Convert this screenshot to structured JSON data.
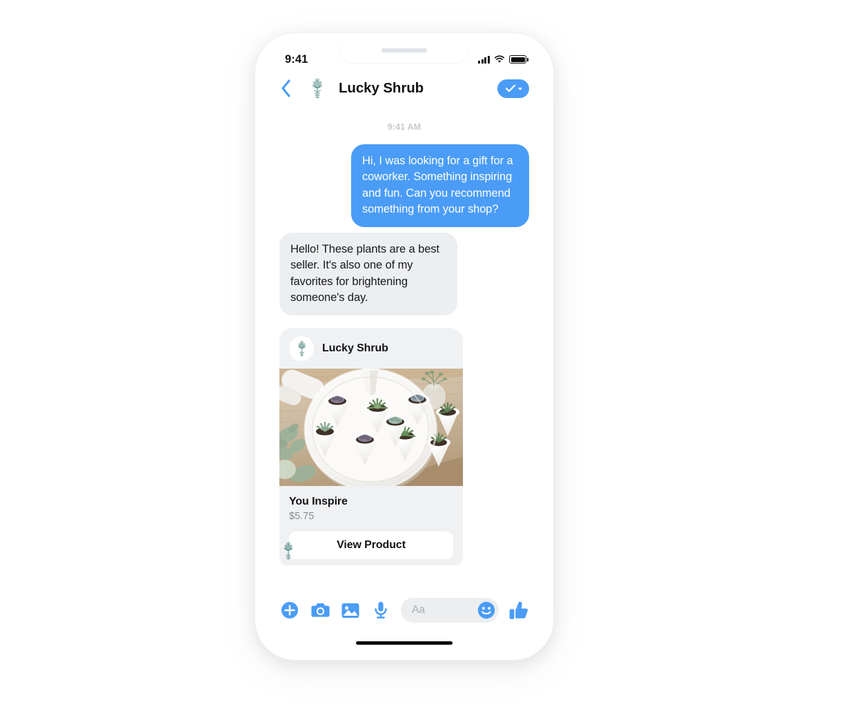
{
  "status_bar": {
    "time": "9:41",
    "signal_icon": "signal-bars-icon",
    "wifi_icon": "wifi-icon",
    "battery_icon": "battery-icon"
  },
  "header": {
    "back_icon": "chevron-left-icon",
    "logo_icon": "lucky-shrub-logo-icon",
    "title": "Lucky Shrub",
    "verified_icon": "check-icon",
    "verified_caret_icon": "caret-down-icon"
  },
  "conversation": {
    "timestamp": "9:41 AM",
    "messages": [
      {
        "direction": "out",
        "text": "Hi, I was looking for a gift for a coworker. Something inspiring and fun. Can you recommend something from your shop?"
      },
      {
        "direction": "in",
        "text": "Hello! These plants are a best seller. It's also one of my favorites for brightening someone's day."
      }
    ],
    "thread_avatar_icon": "lucky-shrub-avatar-icon"
  },
  "product_card": {
    "brand": "Lucky Shrub",
    "brand_avatar_icon": "lucky-shrub-avatar-icon",
    "photo_alt": "White round tray with succulent plants in cone holders on a wooden table",
    "name": "You Inspire",
    "price": "$5.75",
    "cta_label": "View Product"
  },
  "composer": {
    "add_icon": "plus-circle-icon",
    "camera_icon": "camera-icon",
    "gallery_icon": "image-icon",
    "mic_icon": "microphone-icon",
    "input_value": "",
    "input_placeholder": "Aa",
    "emoji_icon": "smiley-icon",
    "like_icon": "thumbs-up-icon"
  },
  "colors": {
    "accent_blue": "#4a9cf6",
    "incoming_bubble": "#eceef0",
    "card_background": "#f0f1f3",
    "brand_green": "#6f9e9a"
  }
}
